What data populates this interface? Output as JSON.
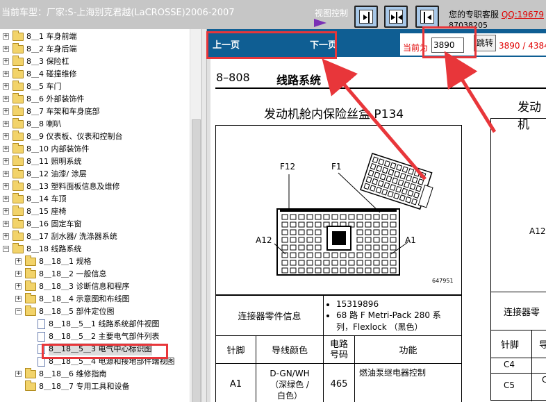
{
  "window": {
    "title": "当前车型：厂家:S-上海别克君越(LaCROSSE)2006-2007",
    "view_control_label": "视图控制",
    "support_label": "您的专职客服",
    "support_qq": "QQ:19679",
    "support_number": "87038205"
  },
  "tree": {
    "items": [
      {
        "label": "8＿1 车身前端",
        "level": 0,
        "expand": "+"
      },
      {
        "label": "8＿2 车身后端",
        "level": 0,
        "expand": "+"
      },
      {
        "label": "8＿3 保险杠",
        "level": 0,
        "expand": "+"
      },
      {
        "label": "8＿4 碰撞维修",
        "level": 0,
        "expand": "+"
      },
      {
        "label": "8＿5 车门",
        "level": 0,
        "expand": "+"
      },
      {
        "label": "8＿6 外部装饰件",
        "level": 0,
        "expand": "+"
      },
      {
        "label": "8＿7 车架和车身底部",
        "level": 0,
        "expand": "+"
      },
      {
        "label": "8＿8 喇叭",
        "level": 0,
        "expand": "+"
      },
      {
        "label": "8＿9 仪表板、仪表和控制台",
        "level": 0,
        "expand": "+"
      },
      {
        "label": "8＿10 内部装饰件",
        "level": 0,
        "expand": "+"
      },
      {
        "label": "8＿11 照明系统",
        "level": 0,
        "expand": "+"
      },
      {
        "label": "8＿12 油漆/ 涂层",
        "level": 0,
        "expand": "+"
      },
      {
        "label": "8＿13 塑料面板信息及维修",
        "level": 0,
        "expand": "+"
      },
      {
        "label": "8＿14 车顶",
        "level": 0,
        "expand": "+"
      },
      {
        "label": "8＿15 座椅",
        "level": 0,
        "expand": "+"
      },
      {
        "label": "8＿16 固定车窗",
        "level": 0,
        "expand": "+"
      },
      {
        "label": "8＿17 刮水器/ 洗涤器系统",
        "level": 0,
        "expand": "+"
      },
      {
        "label": "8＿18 线路系统",
        "level": 0,
        "expand": "-"
      },
      {
        "label": "8＿18＿1 规格",
        "level": 1,
        "expand": "+"
      },
      {
        "label": "8＿18＿2 一般信息",
        "level": 1,
        "expand": "+"
      },
      {
        "label": "8＿18＿3 诊断信息和程序",
        "level": 1,
        "expand": "+"
      },
      {
        "label": "8＿18＿4 示意图和布线图",
        "level": 1,
        "expand": "+"
      },
      {
        "label": "8＿18＿5 部件定位图",
        "level": 1,
        "expand": "-"
      },
      {
        "label": "8＿18＿5＿1 线路系统部件视图",
        "level": 2,
        "expand": ""
      },
      {
        "label": "8＿18＿5＿2 主要电气部件列表",
        "level": 2,
        "expand": ""
      },
      {
        "label": "8＿18＿5＿3 电气中心标识图",
        "level": 2,
        "expand": "",
        "selected": true
      },
      {
        "label": "8＿18＿5＿4 电源和接地部件端视图",
        "level": 2,
        "expand": ""
      },
      {
        "label": "8＿18＿6 维修指南",
        "level": 1,
        "expand": "+"
      },
      {
        "label": "8＿18＿7 专用工具和设备",
        "level": 1,
        "expand": ""
      }
    ]
  },
  "nav": {
    "prev": "上一页",
    "next": "下一页",
    "current_label": "当前为",
    "page_value": "3890",
    "jump": "跳转",
    "page_total": "3890 / 4384"
  },
  "doc": {
    "page_code": "8–808",
    "section": "线路系统",
    "diagram_title": "发动机舱内保险丝盒 P134",
    "diagram_title_right": "发动机",
    "labels": {
      "f12": "F12",
      "f1": "F1",
      "a12": "A12",
      "a1": "A1",
      "a12_right": "A12",
      "fig": "647951"
    },
    "connector_info_label": "连接器零件信息",
    "connector_info": [
      "15319896",
      "68 路 F Metri-Pack 280 系列，Flexlock （黑色）"
    ],
    "table_headers": [
      "针脚",
      "导线颜色",
      "电路\n号码",
      "功能"
    ],
    "rows": [
      {
        "pin": "A1",
        "color": "D-GN/WH\n（深绿色 /\n白色）",
        "circuit": "465",
        "function": "燃油泵继电器控制"
      }
    ],
    "right_table": {
      "info_label": "连接器零",
      "header": "针脚",
      "header2": "导",
      "pins": [
        "C4",
        "C5"
      ],
      "c5_color": "C"
    }
  },
  "colors": {
    "title_bar": "#c6c6c6",
    "nav_bar": "#0f5e93",
    "highlight_red": "#e8363a",
    "accent_purple": "#7a2fb5"
  }
}
